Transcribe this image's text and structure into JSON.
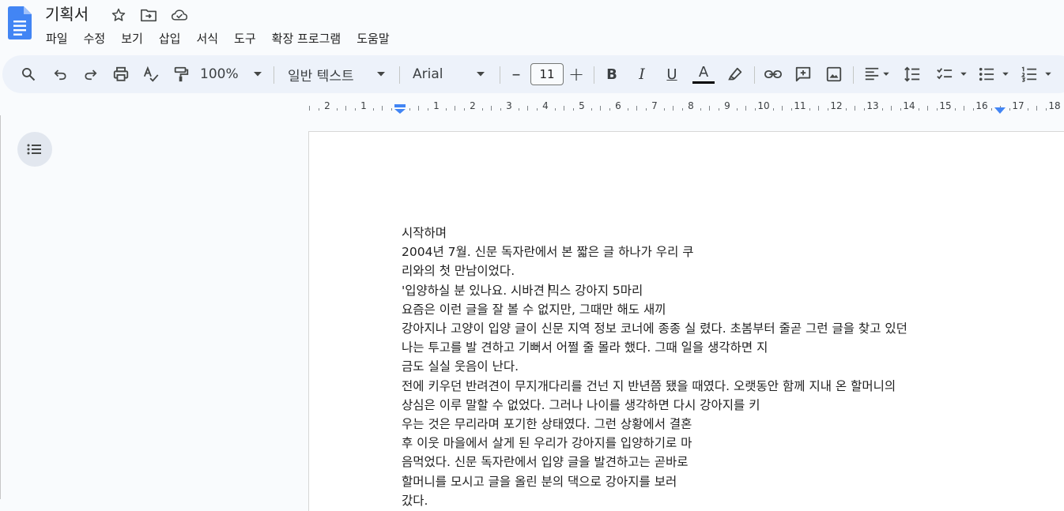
{
  "document": {
    "title": "기획서"
  },
  "menu": [
    "파일",
    "수정",
    "보기",
    "삽입",
    "서식",
    "도구",
    "확장 프로그램",
    "도움말"
  ],
  "toolbar": {
    "zoom": "100%",
    "style": "일반 텍스트",
    "font": "Arial",
    "font_size": "11",
    "minus": "–",
    "plus": "+",
    "bold": "B",
    "italic": "I",
    "underline": "U",
    "text_color_letter": "A",
    "text_color": "#000000"
  },
  "ruler": {
    "labels": [
      "2",
      "1",
      "1",
      "2",
      "3",
      "4",
      "5",
      "6",
      "7",
      "8",
      "9",
      "10",
      "11",
      "12",
      "13",
      "14",
      "15",
      "16",
      "17",
      "18"
    ]
  },
  "body": {
    "lines": [
      "시작하며",
      "2004년 7월. 신문 독자란에서 본 짧은 글 하나가 우리 쿠",
      "리와의 첫 만남이었다.",
      "'입양하실 분 있나요. 시바견 믹스 강아지 5마리",
      "요즘은 이런 글을 잘 볼 수 없지만, 그때만 해도 새끼",
      "강아지나 고양이 입양 글이 신문 지역 정보 코너에 종종 실 렸다. 초봄부터 줄곧 그런 글을 찾고 있던",
      "나는 투고를 발 견하고 기뻐서 어쩔 줄 몰라 했다. 그때 일을 생각하면 지",
      "금도 실실 웃음이 난다.",
      "전에 키우던 반려견이 무지개다리를 건넌 지 반년쯤 됐을 때였다. 오랫동안 함께 지내 온 할머니의",
      "상심은 이루 말할 수 없었다. 그러나 나이를 생각하면 다시 강아지를 키",
      "우는 것은 무리라며 포기한 상태였다. 그런 상황에서 결혼",
      "후 이웃 마을에서 살게 된 우리가 강아지를 입양하기로 마",
      "음먹었다. 신문 독자란에서 입양 글을 발견하고는 곧바로",
      "할머니를 모시고 글을 올린 분의 댁으로 강아지를 보러",
      "갔다."
    ]
  }
}
